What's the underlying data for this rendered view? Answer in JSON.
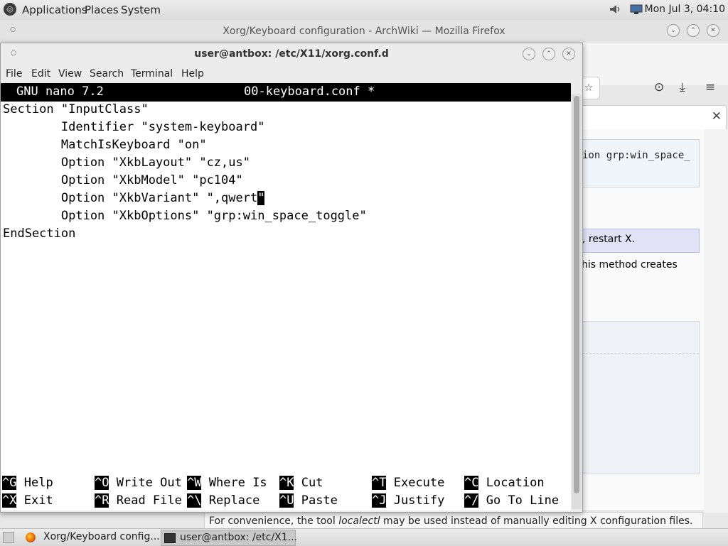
{
  "top_panel": {
    "menus": [
      "Applications",
      "Places",
      "System"
    ],
    "clock": "Mon Jul 3, 04:10"
  },
  "firefox": {
    "title": "Xorg/Keyboard configuration - ArchWiki — Mozilla Firefox",
    "code_fragment": "ion grp:win_space_",
    "note_fragment": ", restart X.",
    "text_fragment": "his method creates",
    "status": {
      "prefix": "For convenience, the tool ",
      "italic": "localectl",
      "suffix": " may be used instead of manually editing X configuration files."
    }
  },
  "terminal": {
    "title": "user@antbox: /etc/X11/xorg.conf.d",
    "menu": [
      "File",
      "Edit",
      "View",
      "Search",
      "Terminal",
      "Help"
    ]
  },
  "nano": {
    "version": "GNU nano 7.2",
    "filename": "00-keyboard.conf *",
    "lines": [
      "Section \"InputClass\"",
      "        Identifier \"system-keyboard\"",
      "        MatchIsKeyboard \"on\"",
      "        Option \"XkbLayout\" \"cz,us\"",
      "        Option \"XkbModel\" \"pc104\"",
      "        Option \"XkbVariant\" \",qwert",
      "        Option \"XkbOptions\" \"grp:win_space_toggle\"",
      "EndSection"
    ],
    "cursor_char": "\"",
    "shortcuts_row1": [
      {
        "key": "^G",
        "label": "Help"
      },
      {
        "key": "^O",
        "label": "Write Out"
      },
      {
        "key": "^W",
        "label": "Where Is"
      },
      {
        "key": "^K",
        "label": "Cut"
      },
      {
        "key": "^T",
        "label": "Execute"
      },
      {
        "key": "^C",
        "label": "Location"
      }
    ],
    "shortcuts_row2": [
      {
        "key": "^X",
        "label": "Exit"
      },
      {
        "key": "^R",
        "label": "Read File"
      },
      {
        "key": "^\\",
        "label": "Replace"
      },
      {
        "key": "^U",
        "label": "Paste"
      },
      {
        "key": "^J",
        "label": "Justify"
      },
      {
        "key": "^/",
        "label": "Go To Line"
      }
    ]
  },
  "taskbar": {
    "items": [
      "Xorg/Keyboard config...",
      "user@antbox: /etc/X1..."
    ]
  },
  "icons": {
    "logo": "distro-logo-icon",
    "volume": "volume-icon",
    "network": "network-icon"
  }
}
